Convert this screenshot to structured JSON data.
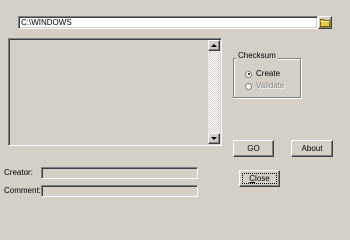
{
  "path": {
    "value": "C:\\WINDOWS"
  },
  "browse": {
    "icon": "folder-icon"
  },
  "output": {
    "text": ""
  },
  "checksum": {
    "title": "Checksum",
    "options": [
      {
        "label": "Create",
        "selected": true,
        "enabled": true
      },
      {
        "label": "Validate",
        "selected": false,
        "enabled": false
      }
    ]
  },
  "buttons": {
    "go": "GO",
    "about": "About",
    "close_first": "C",
    "close_rest": "lose"
  },
  "fields": {
    "creator_label": "Creator:",
    "creator_value": "",
    "comment_label": "Comment:",
    "comment_value": ""
  },
  "colors": {
    "face": "#d4d0c8",
    "shadow": "#808080",
    "highlight": "#ffffff",
    "folder": "#e8c848"
  }
}
